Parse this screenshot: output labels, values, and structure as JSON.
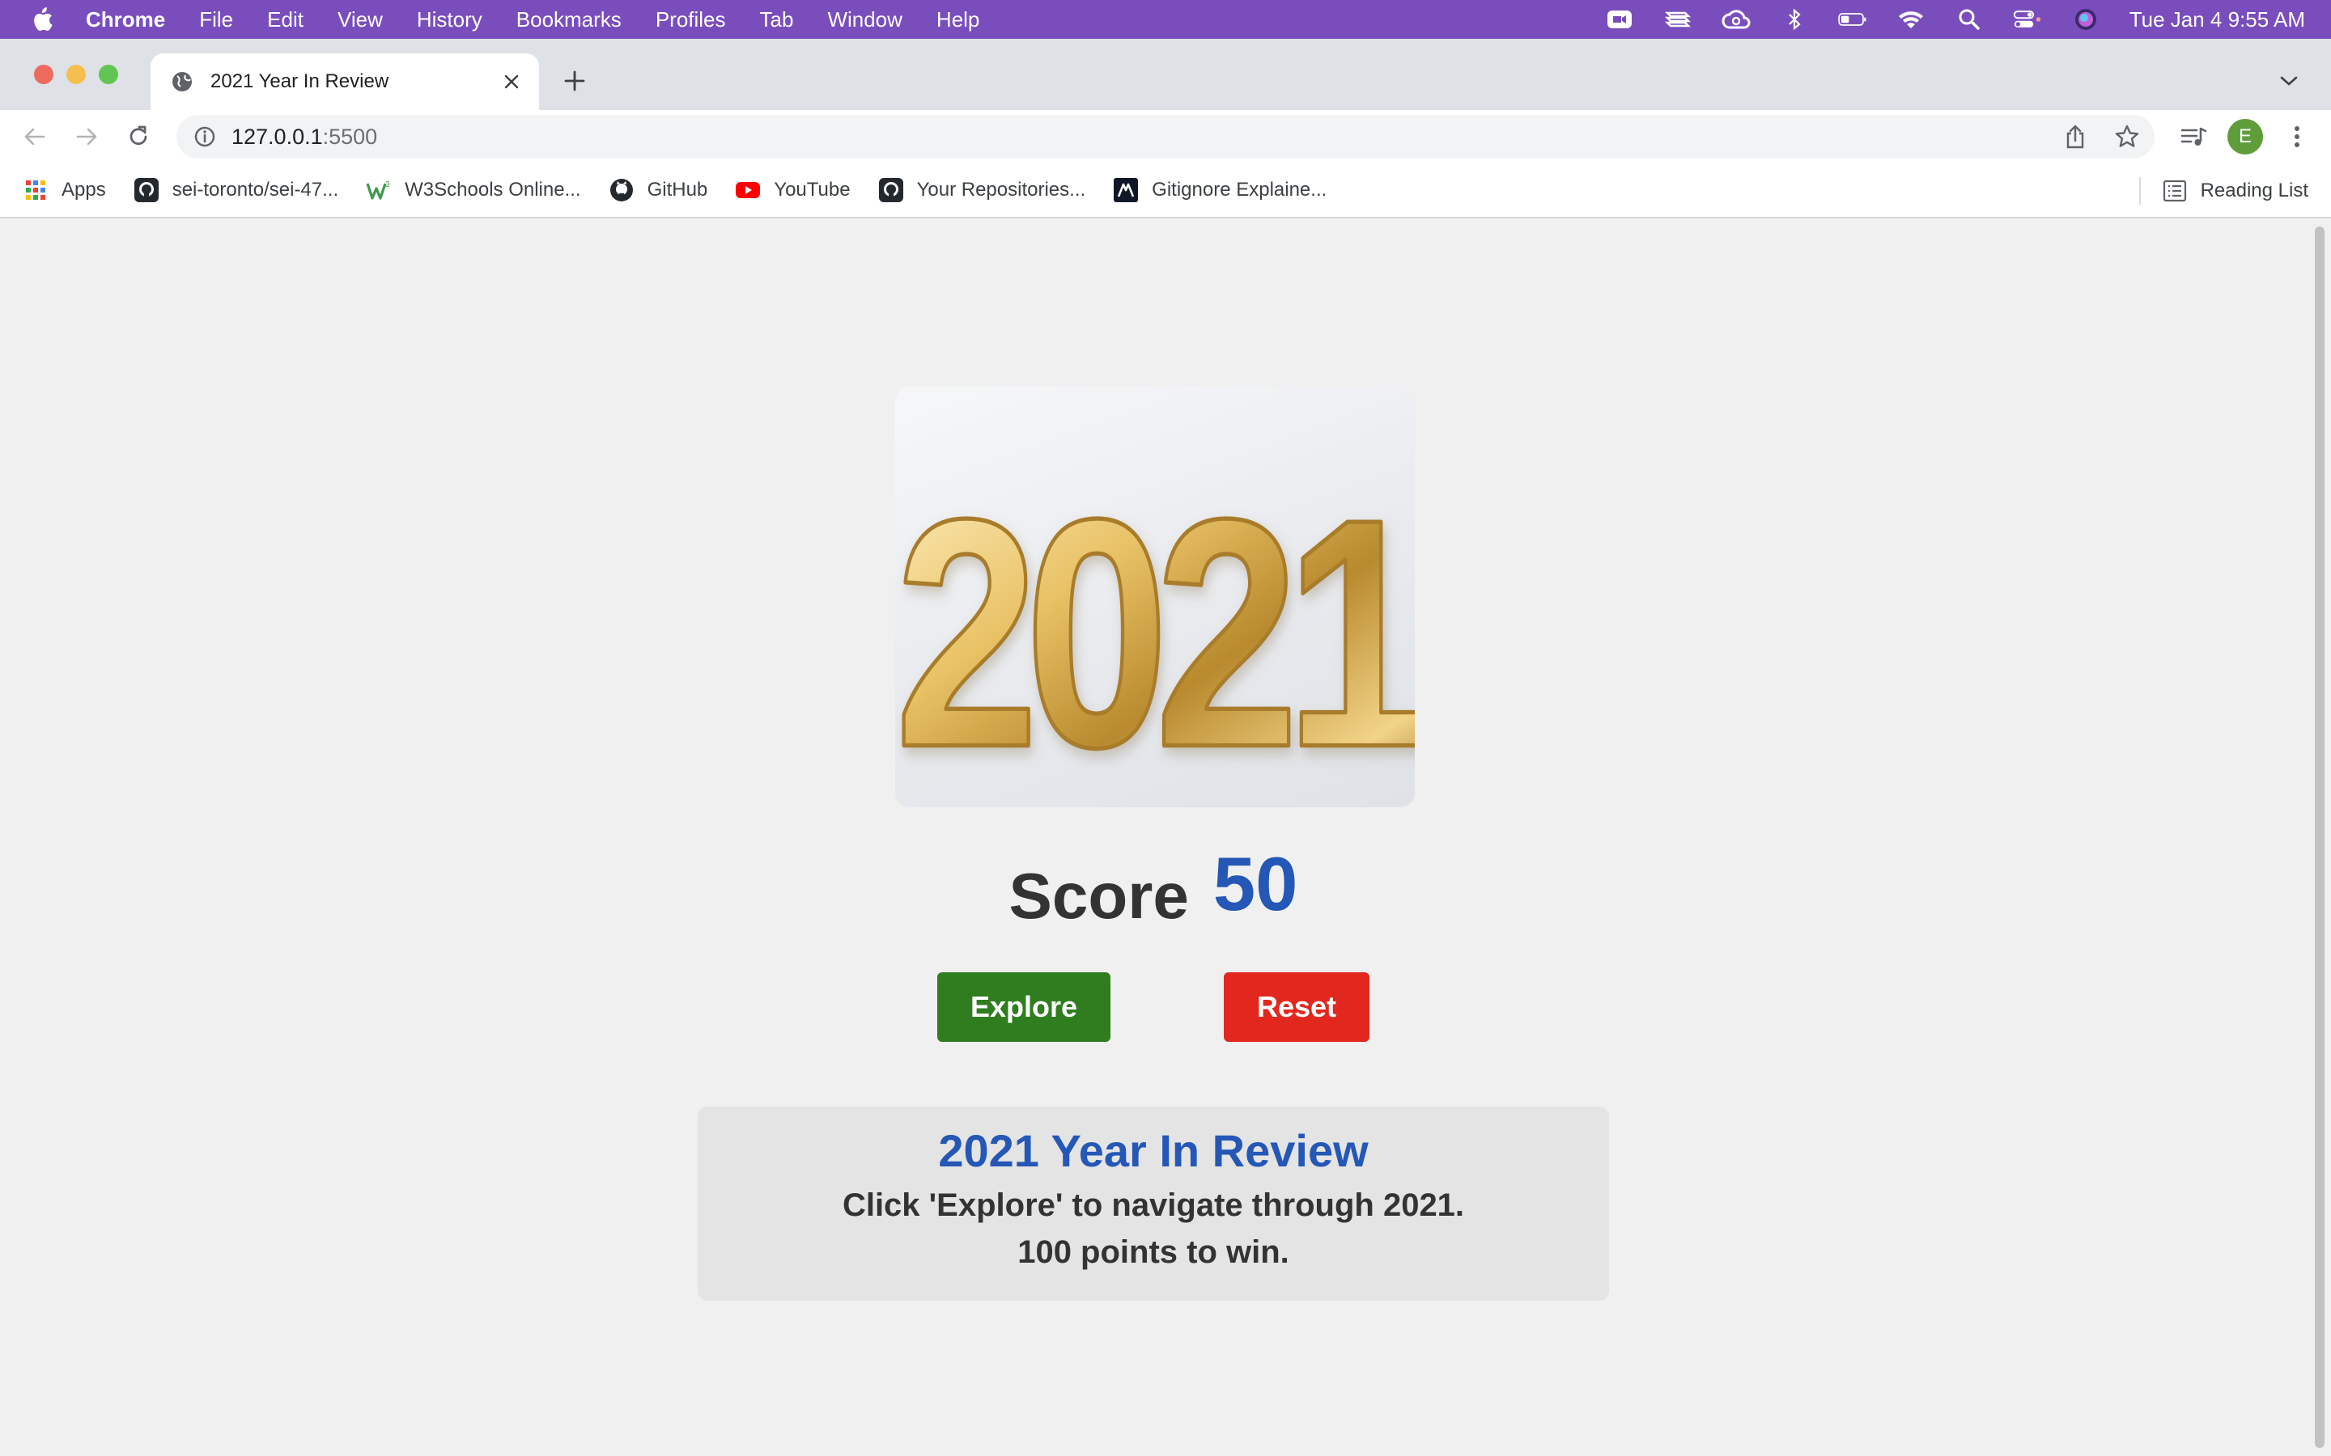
{
  "menubar": {
    "items": [
      {
        "label": "Chrome",
        "bold": true
      },
      {
        "label": "File"
      },
      {
        "label": "Edit"
      },
      {
        "label": "View"
      },
      {
        "label": "History"
      },
      {
        "label": "Bookmarks"
      },
      {
        "label": "Profiles"
      },
      {
        "label": "Tab"
      },
      {
        "label": "Window"
      },
      {
        "label": "Help"
      }
    ],
    "status_icons": [
      "zoom-icon",
      "stacks-icon",
      "creative-cloud-icon",
      "bluetooth-icon",
      "battery-icon",
      "wifi-icon",
      "spotlight-icon",
      "control-center-icon",
      "siri-icon"
    ],
    "clock": "Tue Jan 4  9:55 AM"
  },
  "tab": {
    "title": "2021 Year In Review"
  },
  "omnibox": {
    "host": "127.0.0.1",
    "port": ":5500"
  },
  "profile": {
    "initial": "E",
    "color": "#5f9d3a"
  },
  "bookmarks": [
    {
      "label": "Apps",
      "icon": "apps-grid-icon"
    },
    {
      "label": "sei-toronto/sei-47...",
      "icon": "github-icon"
    },
    {
      "label": "W3Schools Online...",
      "icon": "w3schools-icon"
    },
    {
      "label": "GitHub",
      "icon": "github-icon"
    },
    {
      "label": "YouTube",
      "icon": "youtube-icon"
    },
    {
      "label": "Your Repositories...",
      "icon": "github-icon"
    },
    {
      "label": "Gitignore Explaine...",
      "icon": "gitignore-icon"
    }
  ],
  "reading_list": "Reading List",
  "page": {
    "hero_text": "2021",
    "score_label": "Score",
    "score_value": "50",
    "explore_label": "Explore",
    "reset_label": "Reset",
    "info_title": "2021 Year In Review",
    "info_line1": "Click 'Explore' to navigate through 2021.",
    "info_line2": "100 points to win."
  },
  "colors": {
    "menubar": "#7a4dbd",
    "accent_blue": "#2457b6",
    "explore_green": "#2f7d1f",
    "reset_red": "#e2281e",
    "balloon_gold": "#d9b45a"
  }
}
